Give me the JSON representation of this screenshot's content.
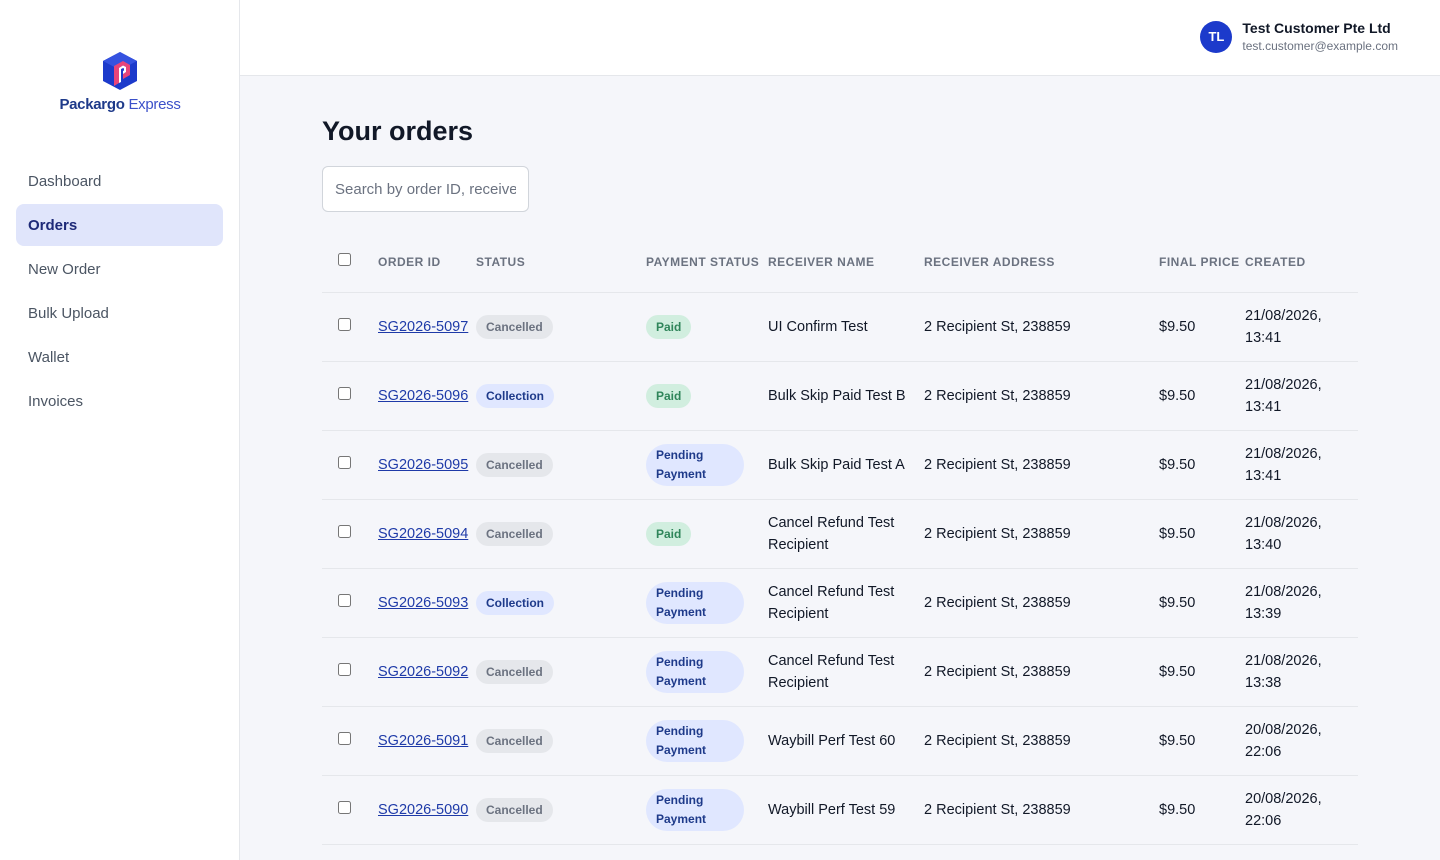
{
  "brand": {
    "name_bold": "Packargo",
    "name_light": "Express"
  },
  "nav": {
    "items": [
      {
        "label": "Dashboard",
        "active": false
      },
      {
        "label": "Orders",
        "active": true
      },
      {
        "label": "New Order",
        "active": false
      },
      {
        "label": "Bulk Upload",
        "active": false
      },
      {
        "label": "Wallet",
        "active": false
      },
      {
        "label": "Invoices",
        "active": false
      }
    ]
  },
  "user": {
    "initials": "TL",
    "name": "Test Customer Pte Ltd",
    "email": "test.customer@example.com"
  },
  "page": {
    "title": "Your orders"
  },
  "search": {
    "placeholder": "Search by order ID, receiver"
  },
  "table": {
    "columns": [
      "ORDER ID",
      "STATUS",
      "PAYMENT STATUS",
      "RECEIVER NAME",
      "RECEIVER ADDRESS",
      "FINAL PRICE",
      "CREATED"
    ],
    "rows": [
      {
        "id": "SG2026-5097",
        "status": "Cancelled",
        "payment": "Paid",
        "receiver": "UI Confirm Test",
        "address": "2 Recipient St, 238859",
        "price": "$9.50",
        "created": "21/08/2026, 13:41"
      },
      {
        "id": "SG2026-5096",
        "status": "Collection",
        "payment": "Paid",
        "receiver": "Bulk Skip Paid Test B",
        "address": "2 Recipient St, 238859",
        "price": "$9.50",
        "created": "21/08/2026, 13:41"
      },
      {
        "id": "SG2026-5095",
        "status": "Cancelled",
        "payment": "Pending Payment",
        "receiver": "Bulk Skip Paid Test A",
        "address": "2 Recipient St, 238859",
        "price": "$9.50",
        "created": "21/08/2026, 13:41"
      },
      {
        "id": "SG2026-5094",
        "status": "Cancelled",
        "payment": "Paid",
        "receiver": "Cancel Refund Test Recipient",
        "address": "2 Recipient St, 238859",
        "price": "$9.50",
        "created": "21/08/2026, 13:40"
      },
      {
        "id": "SG2026-5093",
        "status": "Collection",
        "payment": "Pending Payment",
        "receiver": "Cancel Refund Test Recipient",
        "address": "2 Recipient St, 238859",
        "price": "$9.50",
        "created": "21/08/2026, 13:39"
      },
      {
        "id": "SG2026-5092",
        "status": "Cancelled",
        "payment": "Pending Payment",
        "receiver": "Cancel Refund Test Recipient",
        "address": "2 Recipient St, 238859",
        "price": "$9.50",
        "created": "21/08/2026, 13:38"
      },
      {
        "id": "SG2026-5091",
        "status": "Cancelled",
        "payment": "Pending Payment",
        "receiver": "Waybill Perf Test 60",
        "address": "2 Recipient St, 238859",
        "price": "$9.50",
        "created": "20/08/2026, 22:06"
      },
      {
        "id": "SG2026-5090",
        "status": "Cancelled",
        "payment": "Pending Payment",
        "receiver": "Waybill Perf Test 59",
        "address": "2 Recipient St, 238859",
        "price": "$9.50",
        "created": "20/08/2026, 22:06"
      }
    ]
  }
}
